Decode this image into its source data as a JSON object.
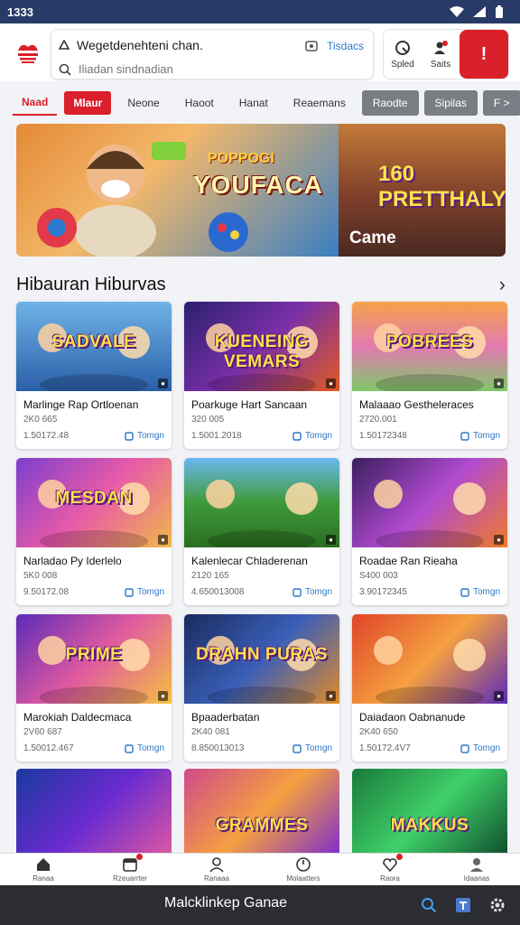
{
  "status": {
    "time": "1333"
  },
  "header": {
    "url_text": "Wegetdenehteni chan.",
    "url_aux": "Tisdacs",
    "search_placeholder": "Iliadan sindnadian",
    "actions": [
      {
        "label": "Spled"
      },
      {
        "label": "Saits"
      }
    ],
    "red_button": "!"
  },
  "tabs": [
    {
      "label": "Naad",
      "style": "active"
    },
    {
      "label": "Mlaur",
      "style": "red"
    },
    {
      "label": "Neone",
      "style": "plain"
    },
    {
      "label": "Haoot",
      "style": "plain"
    },
    {
      "label": "Hanat",
      "style": "plain"
    },
    {
      "label": "Reaemans",
      "style": "plain"
    },
    {
      "label": "Raodte",
      "style": "gray"
    },
    {
      "label": "Sipilas",
      "style": "gray"
    },
    {
      "label": "F >",
      "style": "gray"
    }
  ],
  "banner": {
    "left_small": "POPPOGI",
    "left_title": "YOUFACA",
    "right_title": "160 PRETTHALY",
    "right_label": "Came"
  },
  "section": {
    "title": "Hibauran Hiburvas"
  },
  "cards": [
    {
      "thumb": "SADVALE",
      "title": "Marlinge Rap Ortloenan",
      "meta": "2K0 665",
      "date": "1.50172.48",
      "btn": "Tomgn",
      "bg": "linear-gradient(180deg,#6fb3e8,#2a5fa8)"
    },
    {
      "thumb": "KUENEING VEMARS",
      "title": "Poarkuge Hart Sancaan",
      "meta": "320 005",
      "date": "1.5001.2018",
      "btn": "Tomgn",
      "bg": "linear-gradient(135deg,#2a1f6e,#7a2fa8,#e05a20)"
    },
    {
      "thumb": "POBREES",
      "title": "Malaaao Gestheleraces",
      "meta": "2720.001",
      "date": "1.50172348",
      "btn": "Tomgn",
      "bg": "linear-gradient(180deg,#f6a24a,#e27ab0,#7fc86a)"
    },
    {
      "thumb": "MESDAN",
      "title": "Narladao Py Iderlelo",
      "meta": "5K0 008",
      "date": "9.50172.08",
      "btn": "Tomgn",
      "bg": "linear-gradient(135deg,#7b3fd0,#e85aa8,#f0b84a)"
    },
    {
      "thumb": "",
      "title": "Kalenlecar Chladerenan",
      "meta": "2120 165",
      "date": "4.650013008",
      "btn": "Tomgn",
      "bg": "linear-gradient(180deg,#6ab8f0,#3f9a3a,#2b6e22)"
    },
    {
      "thumb": "",
      "title": "Roadae Ran Rieaha",
      "meta": "S400 003",
      "date": "3.90172345",
      "btn": "Tomgn",
      "bg": "linear-gradient(135deg,#3a1f5e,#b04ad0,#f07a2a)"
    },
    {
      "thumb": "PRIME",
      "title": "Marokiah Daldecmaca",
      "meta": "2V60 687",
      "date": "1.50012.467",
      "btn": "Tomgn",
      "bg": "linear-gradient(135deg,#5b2ab8,#e05aa0,#f5c040)"
    },
    {
      "thumb": "DRAHN PURAS",
      "title": "Bpaaderbatan",
      "meta": "2K40 081",
      "date": "8.850013013",
      "btn": "Tomgn",
      "bg": "linear-gradient(135deg,#1a2a5e,#3a5fb8,#e08a2a)"
    },
    {
      "thumb": "",
      "title": "Daiadaon Oabnanude",
      "meta": "2K40 650",
      "date": "1.50172.4V7",
      "btn": "Tomgn",
      "bg": "linear-gradient(135deg,#e0442a,#f5a040,#5b2ab8)"
    }
  ],
  "partial_cards": [
    {
      "thumb": "",
      "bg": "linear-gradient(135deg,#1a3a9e,#6a2ad0,#e05aa0)"
    },
    {
      "thumb": "GRAMMES",
      "bg": "linear-gradient(135deg,#d04a8a,#f5a040,#7a2ad0)"
    },
    {
      "thumb": "MAKKUS",
      "bg": "linear-gradient(135deg,#1a7a3a,#3fd06a,#0e4a2a)"
    }
  ],
  "bottom_nav": [
    {
      "label": "Ranaa",
      "icon": "home-icon",
      "dot": false
    },
    {
      "label": "Rzeuarrter",
      "icon": "calendar-icon",
      "dot": true
    },
    {
      "label": "Ranaaa",
      "icon": "user-icon",
      "dot": false
    },
    {
      "label": "Molaatters",
      "icon": "clock-icon",
      "dot": false
    },
    {
      "label": "Raora",
      "icon": "heart-icon",
      "dot": true
    },
    {
      "label": "Idaanas",
      "icon": "profile-icon",
      "dot": false
    }
  ],
  "system_bar": {
    "title": "Malcklinkep Ganae"
  },
  "colors": {
    "brand_red": "#d9202b",
    "status_bar": "#283a66",
    "link_blue": "#2a78c8"
  }
}
